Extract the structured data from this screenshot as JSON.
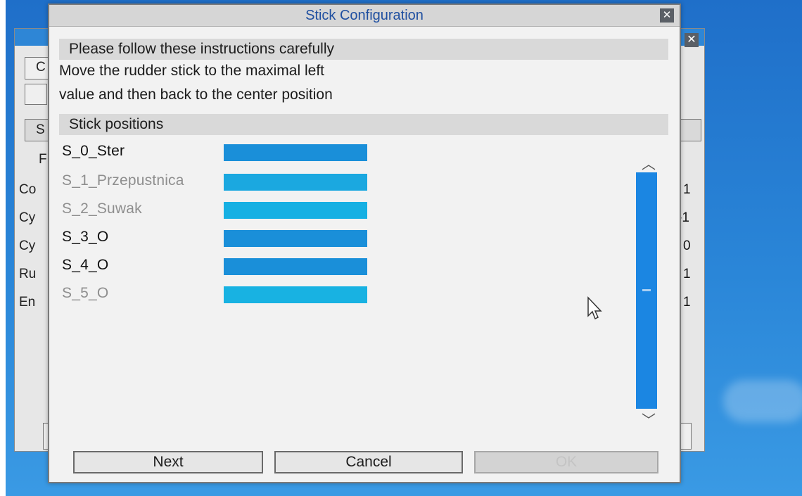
{
  "dialog": {
    "title": "Stick Configuration",
    "close_glyph": "✕",
    "instructions_header": "Please follow these instructions carefully",
    "instructions_lines": [
      "Move the rudder stick to the maximal left",
      "value and then back to the center position"
    ],
    "positions_header": "Stick positions",
    "sticks": [
      {
        "label": "S_0_Ster",
        "active": true,
        "color": "#1a8fd9"
      },
      {
        "label": "S_1_Przepustnica",
        "active": false,
        "color": "#1ba8e0"
      },
      {
        "label": "S_2_Suwak",
        "active": false,
        "color": "#16b0e3"
      },
      {
        "label": "S_3_O",
        "active": true,
        "color": "#1a8fd9"
      },
      {
        "label": "S_4_O",
        "active": true,
        "color": "#1a8fd9"
      },
      {
        "label": "S_5_O",
        "active": false,
        "color": "#18b2e2"
      }
    ],
    "scroll_up_glyph": "︿",
    "scroll_down_glyph": "﹀",
    "buttons": {
      "next": "Next",
      "cancel": "Cancel",
      "ok": "OK"
    }
  },
  "background_window": {
    "close_glyph": "✕",
    "row_labels": [
      "C",
      "",
      "S",
      "F",
      "Co",
      "Cy",
      "Cy",
      "Ru",
      "En"
    ],
    "values": [
      "1",
      "-1",
      "0",
      "1",
      "1"
    ]
  },
  "colors": {
    "accent": "#1b86e2",
    "desktop": "#2a86d8"
  }
}
